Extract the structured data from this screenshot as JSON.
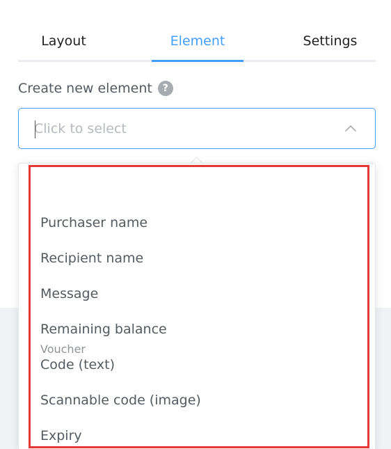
{
  "tabs": [
    {
      "label": "Layout",
      "active": false
    },
    {
      "label": "Element",
      "active": true
    },
    {
      "label": "Settings",
      "active": false
    }
  ],
  "field": {
    "label": "Create new element",
    "help_icon": "question-circle-icon",
    "help_glyph": "?"
  },
  "select": {
    "placeholder": "Click to select",
    "value": "",
    "open": true,
    "icon": "chevron-up-icon"
  },
  "dropdown": {
    "group_title": "Voucher",
    "options": [
      "Purchaser name",
      "Recipient name",
      "Message",
      "Remaining balance",
      "Code (text)",
      "Scannable code (image)",
      "Expiry"
    ]
  },
  "colors": {
    "accent": "#409eff",
    "text": "#555a61",
    "placeholder": "#b6b9bf",
    "group_title": "#909399",
    "highlight": "#e53935",
    "background_band": "#f0f2f6"
  }
}
